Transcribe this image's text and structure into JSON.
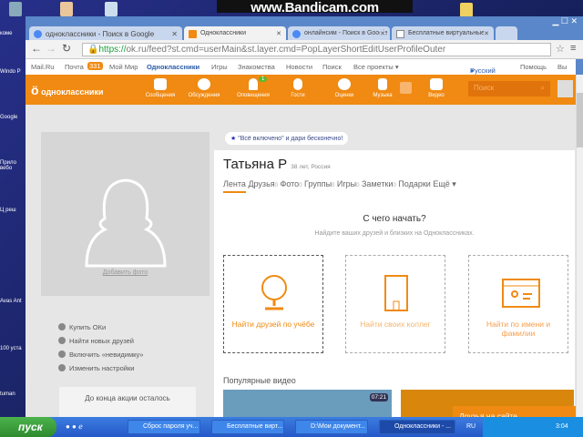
{
  "desktop": {
    "icons": [
      "коме",
      "Windo P",
      "Google",
      "Прило вебо",
      "Ц реш",
      "Avas Ant",
      "100 уста",
      "tuman"
    ]
  },
  "watermark": "www.Bandicam.com",
  "browser": {
    "tabs": [
      {
        "label": "одноклассники - Поиск в Google"
      },
      {
        "label": "Одноклассники"
      },
      {
        "label": "онлайнсим - Поиск в Google"
      },
      {
        "label": "Бесплатные виртуальные"
      }
    ],
    "url_scheme": "https://",
    "url": "ok.ru/feed?st.cmd=userMain&st.layer.cmd=PopLayerShortEditUserProfileOuter"
  },
  "portal": {
    "links": [
      "Mail.Ru",
      "Почта",
      "Мой Мир",
      "Одноклассники",
      "Игры",
      "Знакомства",
      "Новости",
      "Поиск",
      "Все проекты ▾"
    ],
    "mail_count": "331",
    "lang": "Русский ▾",
    "help": "Помощь",
    "exit": "Вы"
  },
  "header": {
    "logo": "одноклассники",
    "nav": [
      {
        "label": "Сообщения",
        "icon": "envelope-icon"
      },
      {
        "label": "Обсуждения",
        "icon": "chat-icon"
      },
      {
        "label": "Оповещения",
        "icon": "bell-icon",
        "badge": "1"
      },
      {
        "label": "Гости",
        "icon": "footprints-icon"
      },
      {
        "label": "Оценки",
        "icon": "rating-icon"
      },
      {
        "label": "Музыка",
        "icon": "music-icon"
      },
      {
        "label": "Видео",
        "icon": "video-icon"
      }
    ],
    "search_placeholder": "Поиск"
  },
  "sidebar": {
    "add_photo": "Добавить фото",
    "menu": [
      "Купить ОКи",
      "Найти новых друзей",
      "Включить «невидимку»",
      "Изменить настройки"
    ],
    "promo": "До конца акции осталось"
  },
  "profile": {
    "banner": "\"Всё включено\" и дари бесконечно!",
    "name": "Татьяна Р",
    "meta": "38 лет, Россия",
    "tabs": [
      {
        "label": "Лента",
        "count": ""
      },
      {
        "label": "Друзья",
        "count": "0"
      },
      {
        "label": "Фото",
        "count": "0"
      },
      {
        "label": "Группы",
        "count": "0"
      },
      {
        "label": "Игры",
        "count": "0"
      },
      {
        "label": "Заметки",
        "count": "0"
      },
      {
        "label": "Подарки",
        "count": ""
      },
      {
        "label": "Ещё ▾",
        "count": ""
      }
    ],
    "start_title": "С чего начать?",
    "start_sub": "Найдите ваших друзей и близких на Одноклассниках.",
    "cards": [
      "Найти друзей по учёбе",
      "Найти своих коллег",
      "Найти по имени и фамилии"
    ],
    "popular": "Популярные видео",
    "video_duration": "07:21",
    "friends_online": "Друзья на сайте"
  },
  "taskbar": {
    "start": "пуск",
    "items": [
      "Сброс пароля уч...",
      "Бесплатные вирт...",
      "D:\\Мои документ...",
      "Одноклассники - ..."
    ],
    "lang": "RU",
    "clock": "3:04"
  },
  "colors": {
    "accent": "#f08a12",
    "link": "#2a5aa8"
  }
}
